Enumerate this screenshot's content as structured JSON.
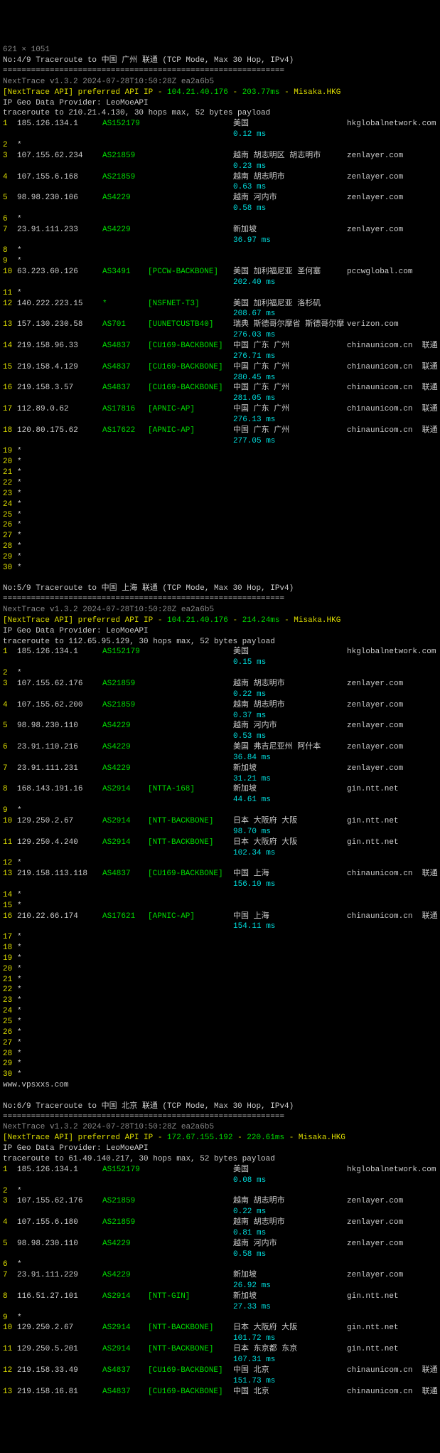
{
  "traces": [
    {
      "header": "No:4/9 Traceroute to 中国 广州 联通 (TCP Mode, Max 30 Hop, IPv4)",
      "divider": "============================================================",
      "version": "NextTrace v1.3.2 2024-07-28T10:50:28Z ea2a6b5",
      "api_prefix": "[NextTrace API] preferred API IP - ",
      "api_ip": "104.21.40.176",
      "api_sep": " - ",
      "api_ms": "203.77ms",
      "api_suffix": " - Misaka.HKG",
      "provider": "IP Geo Data Provider: LeoMoeAPI",
      "tline": "traceroute to 210.21.4.130, 30 hops max, 52 bytes payload",
      "hops": [
        {
          "n": "1",
          "ip": "185.126.134.1",
          "as": "AS152179",
          "net": "",
          "loc": "美国",
          "host": "hkglobalnetwork.com",
          "ms": "0.12 ms"
        },
        {
          "n": "2",
          "ip": "*",
          "as": "",
          "net": "",
          "loc": "",
          "host": "",
          "ms": ""
        },
        {
          "n": "3",
          "ip": "107.155.62.234",
          "as": "AS21859",
          "net": "",
          "loc": "越南 胡志明区 胡志明市",
          "host": "zenlayer.com",
          "ms": "0.23 ms"
        },
        {
          "n": "4",
          "ip": "107.155.6.168",
          "as": "AS21859",
          "net": "",
          "loc": "越南 胡志明市",
          "host": "zenlayer.com",
          "ms": "0.63 ms"
        },
        {
          "n": "5",
          "ip": "98.98.230.106",
          "as": "AS4229",
          "net": "",
          "loc": "越南 河内市",
          "host": "zenlayer.com",
          "ms": "0.58 ms"
        },
        {
          "n": "6",
          "ip": "*",
          "as": "",
          "net": "",
          "loc": "",
          "host": "",
          "ms": ""
        },
        {
          "n": "7",
          "ip": "23.91.111.233",
          "as": "AS4229",
          "net": "",
          "loc": "新加坡",
          "host": "zenlayer.com",
          "ms": "36.97 ms"
        },
        {
          "n": "8",
          "ip": "*",
          "as": "",
          "net": "",
          "loc": "",
          "host": "",
          "ms": ""
        },
        {
          "n": "9",
          "ip": "*",
          "as": "",
          "net": "",
          "loc": "",
          "host": "",
          "ms": ""
        },
        {
          "n": "10",
          "ip": "63.223.60.126",
          "as": "AS3491",
          "net": "[PCCW-BACKBONE]",
          "loc": "美国 加利福尼亚 圣何塞",
          "host": "pccwglobal.com",
          "ms": "202.40 ms"
        },
        {
          "n": "11",
          "ip": "*",
          "as": "",
          "net": "",
          "loc": "",
          "host": "",
          "ms": ""
        },
        {
          "n": "12",
          "ip": "140.222.223.15",
          "as": "*",
          "net": "[NSFNET-T3]",
          "loc": "美国 加利福尼亚 洛杉矶",
          "host": "",
          "ms": "208.67 ms"
        },
        {
          "n": "13",
          "ip": "157.130.230.58",
          "as": "AS701",
          "net": "[UUNETCUSTB40]",
          "loc": "瑞典 斯德哥尔摩省 斯德哥尔摩",
          "host": "verizon.com",
          "ms": "276.03 ms"
        },
        {
          "n": "14",
          "ip": "219.158.96.33",
          "as": "AS4837",
          "net": "[CU169-BACKBONE]",
          "loc": "中国 广东 广州",
          "host": "chinaunicom.cn  联通",
          "ms": "276.71 ms"
        },
        {
          "n": "15",
          "ip": "219.158.4.129",
          "as": "AS4837",
          "net": "[CU169-BACKBONE]",
          "loc": "中国 广东 广州",
          "host": "chinaunicom.cn  联通",
          "ms": "280.45 ms"
        },
        {
          "n": "16",
          "ip": "219.158.3.57",
          "as": "AS4837",
          "net": "[CU169-BACKBONE]",
          "loc": "中国 广东 广州",
          "host": "chinaunicom.cn  联通",
          "ms": "281.05 ms"
        },
        {
          "n": "17",
          "ip": "112.89.0.62",
          "as": "AS17816",
          "net": "[APNIC-AP]",
          "loc": "中国 广东 广州",
          "host": "chinaunicom.cn  联通",
          "ms": "276.13 ms"
        },
        {
          "n": "18",
          "ip": "120.80.175.62",
          "as": "AS17622",
          "net": "[APNIC-AP]",
          "loc": "中国 广东 广州",
          "host": "chinaunicom.cn  联通",
          "ms": "277.05 ms"
        },
        {
          "n": "19",
          "ip": "*",
          "as": "",
          "net": "",
          "loc": "",
          "host": "",
          "ms": ""
        },
        {
          "n": "20",
          "ip": "*",
          "as": "",
          "net": "",
          "loc": "",
          "host": "",
          "ms": ""
        },
        {
          "n": "21",
          "ip": "*",
          "as": "",
          "net": "",
          "loc": "",
          "host": "",
          "ms": ""
        },
        {
          "n": "22",
          "ip": "*",
          "as": "",
          "net": "",
          "loc": "",
          "host": "",
          "ms": ""
        },
        {
          "n": "23",
          "ip": "*",
          "as": "",
          "net": "",
          "loc": "",
          "host": "",
          "ms": ""
        },
        {
          "n": "24",
          "ip": "*",
          "as": "",
          "net": "",
          "loc": "",
          "host": "",
          "ms": ""
        },
        {
          "n": "25",
          "ip": "*",
          "as": "",
          "net": "",
          "loc": "",
          "host": "",
          "ms": ""
        },
        {
          "n": "26",
          "ip": "*",
          "as": "",
          "net": "",
          "loc": "",
          "host": "",
          "ms": ""
        },
        {
          "n": "27",
          "ip": "*",
          "as": "",
          "net": "",
          "loc": "",
          "host": "",
          "ms": ""
        },
        {
          "n": "28",
          "ip": "*",
          "as": "",
          "net": "",
          "loc": "",
          "host": "",
          "ms": ""
        },
        {
          "n": "29",
          "ip": "*",
          "as": "",
          "net": "",
          "loc": "",
          "host": "",
          "ms": ""
        },
        {
          "n": "30",
          "ip": "*",
          "as": "",
          "net": "",
          "loc": "",
          "host": "",
          "ms": ""
        }
      ]
    },
    {
      "header": "No:5/9 Traceroute to 中国 上海 联通 (TCP Mode, Max 30 Hop, IPv4)",
      "divider": "============================================================",
      "version": "NextTrace v1.3.2 2024-07-28T10:50:28Z ea2a6b5",
      "api_prefix": "[NextTrace API] preferred API IP - ",
      "api_ip": "104.21.40.176",
      "api_sep": " - ",
      "api_ms": "214.24ms",
      "api_suffix": " - Misaka.HKG",
      "provider": "IP Geo Data Provider: LeoMoeAPI",
      "tline": "traceroute to 112.65.95.129, 30 hops max, 52 bytes payload",
      "hops": [
        {
          "n": "1",
          "ip": "185.126.134.1",
          "as": "AS152179",
          "net": "",
          "loc": "美国",
          "host": "hkglobalnetwork.com",
          "ms": "0.15 ms"
        },
        {
          "n": "2",
          "ip": "*",
          "as": "",
          "net": "",
          "loc": "",
          "host": "",
          "ms": ""
        },
        {
          "n": "3",
          "ip": "107.155.62.176",
          "as": "AS21859",
          "net": "",
          "loc": "越南 胡志明市",
          "host": "zenlayer.com",
          "ms": "0.22 ms"
        },
        {
          "n": "4",
          "ip": "107.155.62.200",
          "as": "AS21859",
          "net": "",
          "loc": "越南 胡志明市",
          "host": "zenlayer.com",
          "ms": "0.37 ms"
        },
        {
          "n": "5",
          "ip": "98.98.230.110",
          "as": "AS4229",
          "net": "",
          "loc": "越南 河内市",
          "host": "zenlayer.com",
          "ms": "0.53 ms"
        },
        {
          "n": "6",
          "ip": "23.91.110.216",
          "as": "AS4229",
          "net": "",
          "loc": "美国 弗吉尼亚州 阿什本",
          "host": "zenlayer.com",
          "ms": "36.84 ms"
        },
        {
          "n": "7",
          "ip": "23.91.111.231",
          "as": "AS4229",
          "net": "",
          "loc": "新加坡",
          "host": "zenlayer.com",
          "ms": "31.21 ms"
        },
        {
          "n": "8",
          "ip": "168.143.191.16",
          "as": "AS2914",
          "net": "[NTTA-168]",
          "loc": "新加坡",
          "host": "gin.ntt.net",
          "ms": "44.61 ms"
        },
        {
          "n": "9",
          "ip": "*",
          "as": "",
          "net": "",
          "loc": "",
          "host": "",
          "ms": ""
        },
        {
          "n": "10",
          "ip": "129.250.2.67",
          "as": "AS2914",
          "net": "[NTT-BACKBONE]",
          "loc": "日本 大阪府 大阪",
          "host": "gin.ntt.net",
          "ms": "98.70 ms"
        },
        {
          "n": "11",
          "ip": "129.250.4.240",
          "as": "AS2914",
          "net": "[NTT-BACKBONE]",
          "loc": "日本 大阪府 大阪",
          "host": "gin.ntt.net",
          "ms": "102.34 ms"
        },
        {
          "n": "12",
          "ip": "*",
          "as": "",
          "net": "",
          "loc": "",
          "host": "",
          "ms": ""
        },
        {
          "n": "13",
          "ip": "219.158.113.118",
          "as": "AS4837",
          "net": "[CU169-BACKBONE]",
          "loc": "中国 上海",
          "host": "chinaunicom.cn  联通",
          "ms": "156.10 ms"
        },
        {
          "n": "14",
          "ip": "*",
          "as": "",
          "net": "",
          "loc": "",
          "host": "",
          "ms": ""
        },
        {
          "n": "15",
          "ip": "*",
          "as": "",
          "net": "",
          "loc": "",
          "host": "",
          "ms": ""
        },
        {
          "n": "16",
          "ip": "210.22.66.174",
          "as": "AS17621",
          "net": "[APNIC-AP]",
          "loc": "中国 上海",
          "host": "chinaunicom.cn  联通",
          "ms": "154.11 ms"
        },
        {
          "n": "17",
          "ip": "*",
          "as": "",
          "net": "",
          "loc": "",
          "host": "",
          "ms": ""
        },
        {
          "n": "18",
          "ip": "*",
          "as": "",
          "net": "",
          "loc": "",
          "host": "",
          "ms": ""
        },
        {
          "n": "19",
          "ip": "*",
          "as": "",
          "net": "",
          "loc": "",
          "host": "",
          "ms": ""
        },
        {
          "n": "20",
          "ip": "*",
          "as": "",
          "net": "",
          "loc": "",
          "host": "",
          "ms": ""
        },
        {
          "n": "21",
          "ip": "*",
          "as": "",
          "net": "",
          "loc": "",
          "host": "",
          "ms": ""
        },
        {
          "n": "22",
          "ip": "*",
          "as": "",
          "net": "",
          "loc": "",
          "host": "",
          "ms": ""
        },
        {
          "n": "23",
          "ip": "*",
          "as": "",
          "net": "",
          "loc": "",
          "host": "",
          "ms": ""
        },
        {
          "n": "24",
          "ip": "*",
          "as": "",
          "net": "",
          "loc": "",
          "host": "",
          "ms": ""
        },
        {
          "n": "25",
          "ip": "*",
          "as": "",
          "net": "",
          "loc": "",
          "host": "",
          "ms": ""
        },
        {
          "n": "26",
          "ip": "*",
          "as": "",
          "net": "",
          "loc": "",
          "host": "",
          "ms": ""
        },
        {
          "n": "27",
          "ip": "*",
          "as": "",
          "net": "",
          "loc": "",
          "host": "",
          "ms": ""
        },
        {
          "n": "28",
          "ip": "*",
          "as": "",
          "net": "",
          "loc": "",
          "host": "",
          "ms": ""
        },
        {
          "n": "29",
          "ip": "*",
          "as": "",
          "net": "",
          "loc": "",
          "host": "",
          "ms": ""
        },
        {
          "n": "30",
          "ip": "*",
          "as": "",
          "net": "",
          "loc": "",
          "host": "",
          "ms": ""
        }
      ],
      "watermark": "www.vpsxxs.com"
    },
    {
      "header": "No:6/9 Traceroute to 中国 北京 联通 (TCP Mode, Max 30 Hop, IPv4)",
      "divider": "============================================================",
      "version": "NextTrace v1.3.2 2024-07-28T10:50:28Z ea2a6b5",
      "api_prefix": "[NextTrace API] preferred API IP - ",
      "api_ip": "172.67.155.192",
      "api_sep": " - ",
      "api_ms": "220.61ms",
      "api_suffix": " - Misaka.HKG",
      "provider": "IP Geo Data Provider: LeoMoeAPI",
      "tline": "traceroute to 61.49.140.217, 30 hops max, 52 bytes payload",
      "hops": [
        {
          "n": "1",
          "ip": "185.126.134.1",
          "as": "AS152179",
          "net": "",
          "loc": "美国",
          "host": "hkglobalnetwork.com",
          "ms": "0.08 ms"
        },
        {
          "n": "2",
          "ip": "*",
          "as": "",
          "net": "",
          "loc": "",
          "host": "",
          "ms": ""
        },
        {
          "n": "3",
          "ip": "107.155.62.176",
          "as": "AS21859",
          "net": "",
          "loc": "越南 胡志明市",
          "host": "zenlayer.com",
          "ms": "0.22 ms"
        },
        {
          "n": "4",
          "ip": "107.155.6.180",
          "as": "AS21859",
          "net": "",
          "loc": "越南 胡志明市",
          "host": "zenlayer.com",
          "ms": "0.81 ms"
        },
        {
          "n": "5",
          "ip": "98.98.230.110",
          "as": "AS4229",
          "net": "",
          "loc": "越南 河内市",
          "host": "zenlayer.com",
          "ms": "0.58 ms"
        },
        {
          "n": "6",
          "ip": "*",
          "as": "",
          "net": "",
          "loc": "",
          "host": "",
          "ms": ""
        },
        {
          "n": "7",
          "ip": "23.91.111.229",
          "as": "AS4229",
          "net": "",
          "loc": "新加坡",
          "host": "zenlayer.com",
          "ms": "26.92 ms"
        },
        {
          "n": "8",
          "ip": "116.51.27.101",
          "as": "AS2914",
          "net": "[NTT-GIN]",
          "loc": "新加坡",
          "host": "gin.ntt.net",
          "ms": "27.33 ms"
        },
        {
          "n": "9",
          "ip": "*",
          "as": "",
          "net": "",
          "loc": "",
          "host": "",
          "ms": ""
        },
        {
          "n": "10",
          "ip": "129.250.2.67",
          "as": "AS2914",
          "net": "[NTT-BACKBONE]",
          "loc": "日本 大阪府 大阪",
          "host": "gin.ntt.net",
          "ms": "101.72 ms"
        },
        {
          "n": "11",
          "ip": "129.250.5.201",
          "as": "AS2914",
          "net": "[NTT-BACKBONE]",
          "loc": "日本 东京都 东京",
          "host": "gin.ntt.net",
          "ms": "107.31 ms"
        },
        {
          "n": "12",
          "ip": "219.158.33.49",
          "as": "AS4837",
          "net": "[CU169-BACKBONE]",
          "loc": "中国 北京",
          "host": "chinaunicom.cn  联通",
          "ms": "151.73 ms"
        },
        {
          "n": "13",
          "ip": "219.158.16.81",
          "as": "AS4837",
          "net": "[CU169-BACKBONE]",
          "loc": "中国 北京",
          "host": "chinaunicom.cn  联通",
          "ms": ""
        }
      ]
    }
  ],
  "dim_overlay": "621 × 1051"
}
